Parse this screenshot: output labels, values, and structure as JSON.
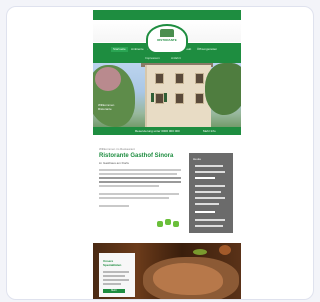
{
  "site": {
    "logo_text": "RISTORANTE",
    "nav_items": [
      "Startseite",
      "Ambiente",
      "Speisen",
      "Mittagstisch",
      "Kontakt",
      "Öffnungszeiten"
    ],
    "sub_nav": [
      "Impressum",
      "Anfahrt"
    ],
    "hero_text_1": "Willkommen",
    "hero_text_2": "Ristorante",
    "hero_bar_1": "Reservierung unter 0000 000 000",
    "hero_bar_2": "Mehr Info",
    "intro": "Willkommen im Restaurant",
    "title": "Ristorante Gasthof Sinora",
    "subtitle": "im Gasthaus am Dorfe",
    "sidebar_caption": "Heute",
    "food_card_heading_1": "Unsere",
    "food_card_heading_2": "Spezialitäten",
    "food_card_button": "Mehr"
  },
  "colors": {
    "brand_green": "#1e8d40",
    "sidebar_gray": "#6b6b6b"
  }
}
